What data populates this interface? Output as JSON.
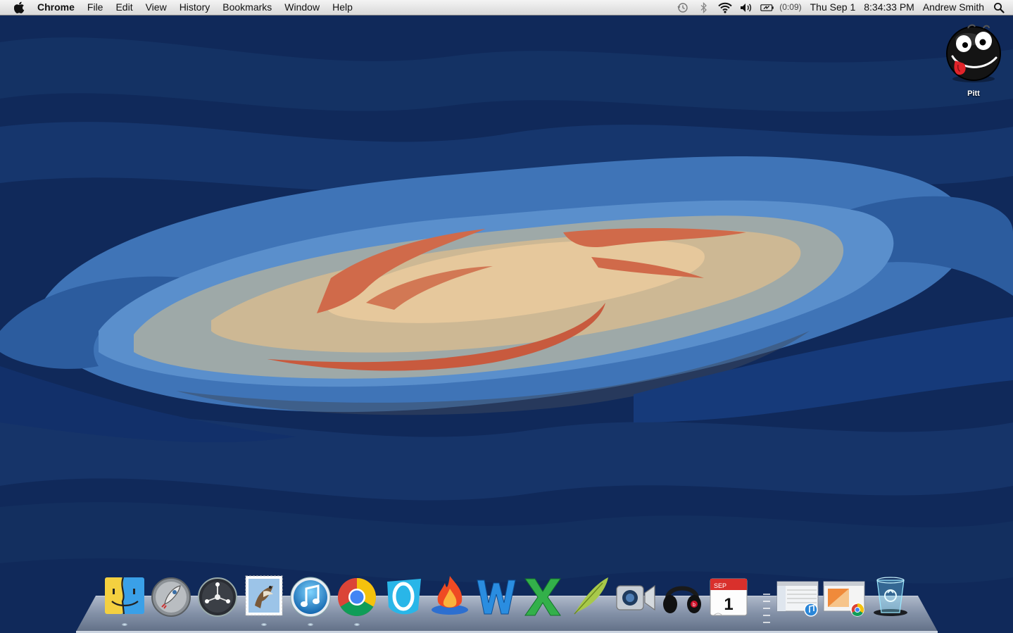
{
  "menubar": {
    "app_name": "Chrome",
    "menus": [
      "File",
      "Edit",
      "View",
      "History",
      "Bookmarks",
      "Window",
      "Help"
    ],
    "status": {
      "battery_time": "(0:09)",
      "date": "Thu Sep 1",
      "time": "8:34:33 PM",
      "user": "Andrew Smith"
    }
  },
  "desktop": {
    "icons": [
      {
        "label": "Pitt",
        "icon": "black-emoji-face-icon"
      }
    ]
  },
  "dock": {
    "apps": [
      {
        "name": "Finder",
        "icon": "finder-icon",
        "running": true
      },
      {
        "name": "Launchpad",
        "icon": "launchpad-rocket-icon",
        "running": false
      },
      {
        "name": "Mission Control",
        "icon": "mission-control-icon",
        "running": false
      },
      {
        "name": "Mail",
        "icon": "mail-stamp-icon",
        "running": true
      },
      {
        "name": "iTunes",
        "icon": "itunes-note-icon",
        "running": true
      },
      {
        "name": "Chrome",
        "icon": "chrome-icon",
        "running": true
      },
      {
        "name": "Opera",
        "icon": "opera-icon",
        "running": false
      },
      {
        "name": "Flame",
        "icon": "flame-icon",
        "running": false
      },
      {
        "name": "Word",
        "icon": "word-w-icon",
        "running": false
      },
      {
        "name": "Excel",
        "icon": "excel-x-icon",
        "running": false
      },
      {
        "name": "Feather",
        "icon": "feather-quill-icon",
        "running": false
      },
      {
        "name": "FaceTime",
        "icon": "facetime-camera-icon",
        "running": false
      },
      {
        "name": "Beats",
        "icon": "beats-headphones-icon",
        "running": false
      },
      {
        "name": "Calendar",
        "icon": "calendar-icon",
        "month": "SEP",
        "day": "1",
        "running": false
      }
    ],
    "minimized": [
      {
        "name": "iTunes window",
        "icon": "itunes-window-thumbnail-icon"
      },
      {
        "name": "Chrome window",
        "icon": "chrome-window-thumbnail-icon"
      }
    ],
    "trash": {
      "name": "Trash",
      "icon": "trash-recycle-icon"
    }
  },
  "colors": {
    "wallpaper_deep": "#0f2a5c",
    "wallpaper_mid": "#234d8a",
    "wallpaper_light": "#4f86c6",
    "galaxy_core": "#e6c89c",
    "galaxy_arm": "#d06a4a"
  }
}
